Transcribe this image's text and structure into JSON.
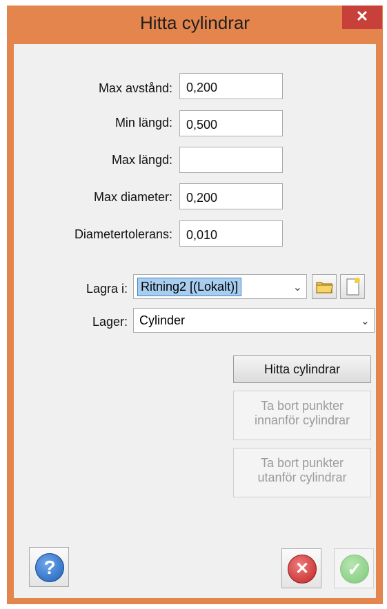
{
  "window": {
    "title": "Hitta cylindrar",
    "close_symbol": "✕"
  },
  "fields": {
    "max_avstand": {
      "label": "Max avstånd:",
      "value": "0,200"
    },
    "min_langd": {
      "label": "Min längd:",
      "value": "0,500"
    },
    "max_langd": {
      "label": "Max längd:",
      "value": ""
    },
    "max_diameter": {
      "label": "Max diameter:",
      "value": "0,200"
    },
    "diametertolerans": {
      "label": "Diametertolerans:",
      "value": "0,010"
    }
  },
  "lagra_i": {
    "label": "Lagra i:",
    "value": "Ritning2 [(Lokalt)]",
    "open_icon": "folder-icon",
    "new_icon": "new-document-icon"
  },
  "lager": {
    "label": "Lager:",
    "value": "Cylinder"
  },
  "buttons": {
    "hitta": "Hitta cylindrar",
    "ta_bort_innanfor": [
      "Ta bort punkter",
      "innanför cylindrar"
    ],
    "ta_bort_utanfor": [
      "Ta bort punkter",
      "utanför cylindrar"
    ]
  },
  "footer": {
    "help_icon": "help-icon",
    "help_symbol": "?",
    "cancel_icon": "cancel-icon",
    "cancel_symbol": "✕",
    "ok_icon": "ok-check-icon",
    "ok_symbol": "✓"
  },
  "colors": {
    "frame": "#e4854e",
    "close": "#c7403a",
    "help": "#2a6fc4",
    "cancel": "#d03a3a",
    "ok": "#6cc36c"
  }
}
